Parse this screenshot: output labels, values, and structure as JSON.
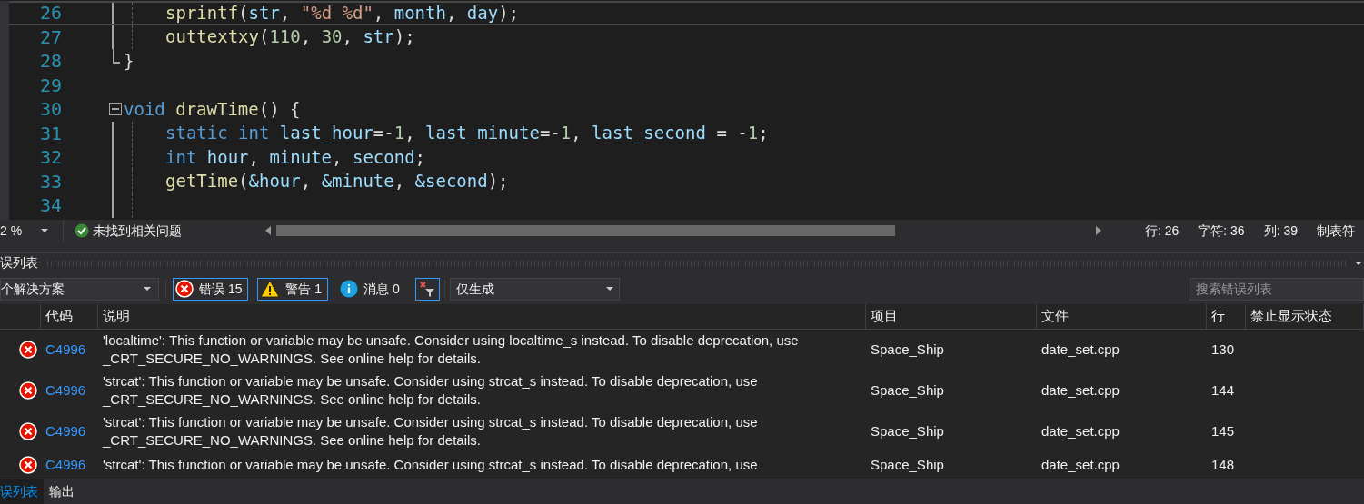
{
  "editor": {
    "lines": [
      {
        "num": "26",
        "kind": "body",
        "current": true,
        "tokens": [
          {
            "t": "sprintf",
            "kind": "fn"
          },
          {
            "t": "(",
            "kind": "p"
          },
          {
            "t": "str",
            "kind": "var"
          },
          {
            "t": ", ",
            "kind": "p"
          },
          {
            "t": "\"%d %d\"",
            "kind": "str"
          },
          {
            "t": ", ",
            "kind": "p"
          },
          {
            "t": "month",
            "kind": "var"
          },
          {
            "t": ", ",
            "kind": "p"
          },
          {
            "t": "day",
            "kind": "var"
          },
          {
            "t": ");",
            "kind": "p"
          }
        ]
      },
      {
        "num": "27",
        "kind": "body",
        "current": false,
        "tokens": [
          {
            "t": "outtextxy",
            "kind": "fn"
          },
          {
            "t": "(",
            "kind": "p"
          },
          {
            "t": "110",
            "kind": "num"
          },
          {
            "t": ", ",
            "kind": "p"
          },
          {
            "t": "30",
            "kind": "num"
          },
          {
            "t": ", ",
            "kind": "p"
          },
          {
            "t": "str",
            "kind": "var"
          },
          {
            "t": ");",
            "kind": "p"
          }
        ]
      },
      {
        "num": "28",
        "kind": "end",
        "current": false,
        "tokens": [
          {
            "t": "}",
            "kind": "p"
          }
        ]
      },
      {
        "num": "29",
        "kind": "blank",
        "current": false
      },
      {
        "num": "30",
        "kind": "open",
        "current": false,
        "tokens": [
          {
            "t": "void ",
            "kind": "kw"
          },
          {
            "t": "drawTime",
            "kind": "fn"
          },
          {
            "t": "() {",
            "kind": "p"
          }
        ]
      },
      {
        "num": "31",
        "kind": "body",
        "current": false,
        "tokens": [
          {
            "t": "static int ",
            "kind": "kw"
          },
          {
            "t": "last_hour",
            "kind": "var"
          },
          {
            "t": "=-",
            "kind": "p"
          },
          {
            "t": "1",
            "kind": "num"
          },
          {
            "t": ", ",
            "kind": "p"
          },
          {
            "t": "last_minute",
            "kind": "var"
          },
          {
            "t": "=-",
            "kind": "p"
          },
          {
            "t": "1",
            "kind": "num"
          },
          {
            "t": ", ",
            "kind": "p"
          },
          {
            "t": "last_second",
            "kind": "var"
          },
          {
            "t": " = -",
            "kind": "p"
          },
          {
            "t": "1",
            "kind": "num"
          },
          {
            "t": ";",
            "kind": "p"
          }
        ]
      },
      {
        "num": "32",
        "kind": "body",
        "current": false,
        "tokens": [
          {
            "t": "int ",
            "kind": "kw"
          },
          {
            "t": "hour",
            "kind": "var"
          },
          {
            "t": ", ",
            "kind": "p"
          },
          {
            "t": "minute",
            "kind": "var"
          },
          {
            "t": ", ",
            "kind": "p"
          },
          {
            "t": "second",
            "kind": "var"
          },
          {
            "t": ";",
            "kind": "p"
          }
        ]
      },
      {
        "num": "33",
        "kind": "body",
        "current": false,
        "tokens": [
          {
            "t": "getTime",
            "kind": "fn"
          },
          {
            "t": "(",
            "kind": "p"
          },
          {
            "t": "&hour",
            "kind": "var"
          },
          {
            "t": ", ",
            "kind": "p"
          },
          {
            "t": "&minute",
            "kind": "var"
          },
          {
            "t": ", ",
            "kind": "p"
          },
          {
            "t": "&second",
            "kind": "var"
          },
          {
            "t": ");",
            "kind": "p"
          }
        ]
      },
      {
        "num": "34",
        "kind": "body",
        "current": false
      }
    ]
  },
  "status_bar": {
    "zoom": "2 %",
    "issues": "未找到相关问题",
    "position": [
      "行: 26",
      "字符: 36",
      "列: 39",
      "制表符"
    ]
  },
  "error_list": {
    "title": "误列表",
    "scope": "个解决方案",
    "filters": [
      {
        "kind": "error",
        "label": "错误 15",
        "selected": true
      },
      {
        "kind": "warning",
        "label": "警告 1",
        "selected": true
      },
      {
        "kind": "info",
        "label": "消息 0",
        "selected": false
      }
    ],
    "clear_filter": {
      "selected": true
    },
    "source": "仅生成",
    "search": {
      "placeholder": "搜索错误列表"
    },
    "columns": [
      "代码",
      "说明",
      "项目",
      "文件",
      "行",
      "禁止显示状态"
    ],
    "rows": [
      {
        "code": "C4996",
        "description": "'localtime': This function or variable may be unsafe. Consider using localtime_s instead. To disable deprecation, use _CRT_SECURE_NO_WARNINGS. See online help for details.",
        "project": "Space_Ship",
        "file": "date_set.cpp",
        "line": "130"
      },
      {
        "code": "C4996",
        "description": "'strcat': This function or variable may be unsafe. Consider using strcat_s instead. To disable deprecation, use _CRT_SECURE_NO_WARNINGS. See online help for details.",
        "project": "Space_Ship",
        "file": "date_set.cpp",
        "line": "144"
      },
      {
        "code": "C4996",
        "description": "'strcat': This function or variable may be unsafe. Consider using strcat_s instead. To disable deprecation, use _CRT_SECURE_NO_WARNINGS. See online help for details.",
        "project": "Space_Ship",
        "file": "date_set.cpp",
        "line": "145"
      },
      {
        "code": "C4996",
        "description": "'strcat': This function or variable may be unsafe. Consider using strcat_s instead. To disable deprecation, use",
        "project": "Space_Ship",
        "file": "date_set.cpp",
        "line": "148"
      }
    ]
  },
  "bottom_tabs": [
    {
      "label": "误列表",
      "selected": true
    },
    {
      "label": "输出",
      "selected": false
    }
  ]
}
